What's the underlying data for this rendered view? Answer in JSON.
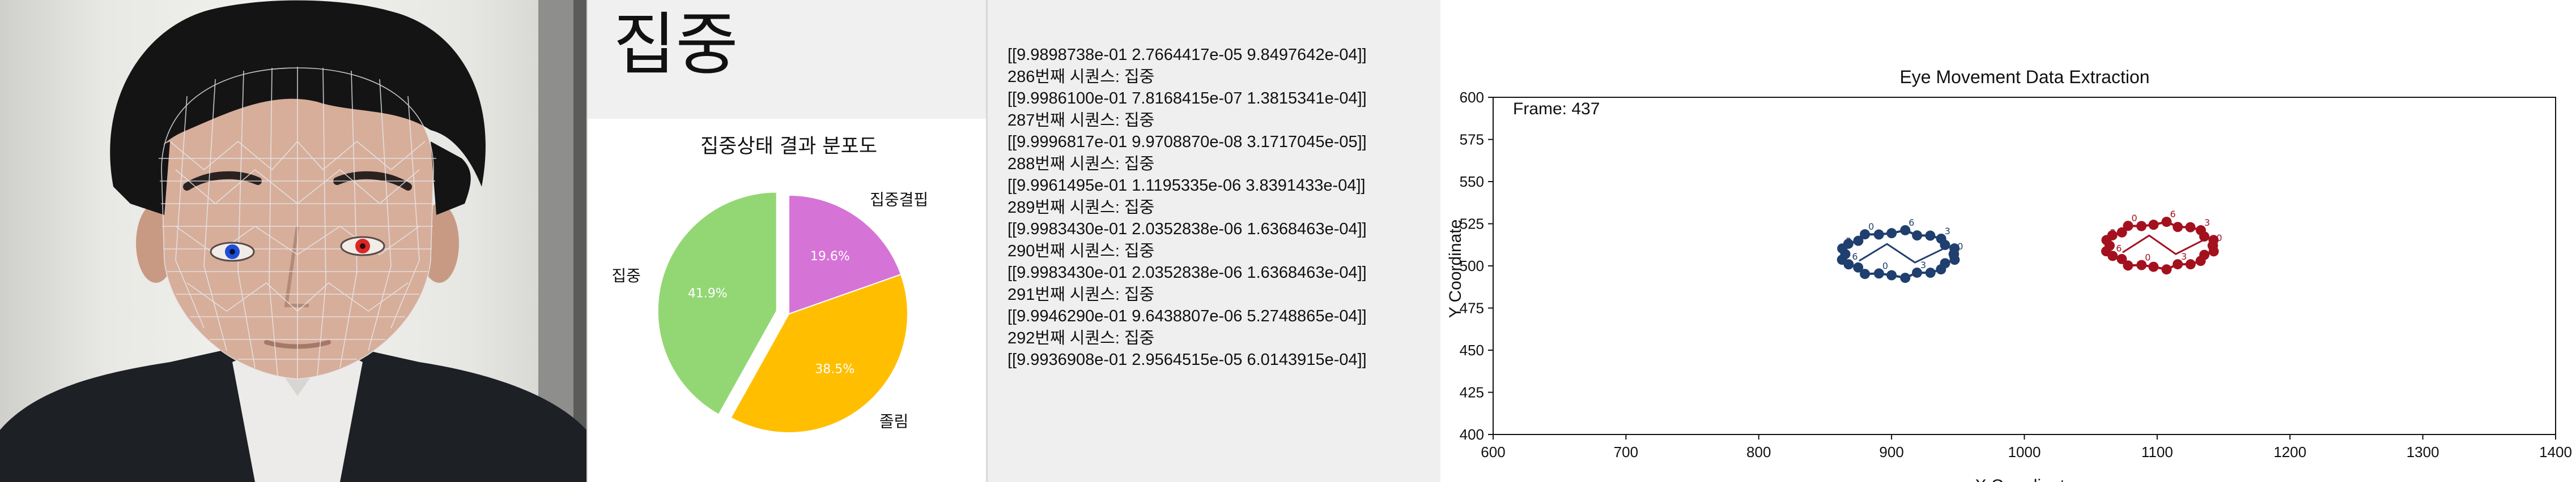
{
  "camera": {
    "description_icons": [
      "face-mesh",
      "left-eye-marker",
      "right-eye-marker"
    ],
    "colors": {
      "left_eye": "#1d4ed8",
      "right_eye": "#dc2626",
      "mesh": "#cfd3d8"
    }
  },
  "dashboard": {
    "state_title": "집중",
    "chart_data": {
      "type": "pie",
      "title": "집중상태 결과 분포도",
      "slices": [
        {
          "label": "집중결핍",
          "value": 19.6,
          "pct_label": "19.6%",
          "color": "#d673d6"
        },
        {
          "label": "졸림",
          "value": 38.5,
          "pct_label": "38.5%",
          "color": "#ffbf00"
        },
        {
          "label": "집중",
          "value": 41.9,
          "pct_label": "41.9%",
          "color": "#93d774"
        }
      ]
    }
  },
  "log": {
    "lines": [
      "[[9.9898738e-01 2.7664417e-05 9.8497642e-04]]",
      "286번째 시퀀스: 집중",
      "[[9.9986100e-01 7.8168415e-07 1.3815341e-04]]",
      "287번째 시퀀스: 집중",
      "[[9.9996817e-01 9.9708870e-08 3.1717045e-05]]",
      "288번째 시퀀스: 집중",
      "[[9.9961495e-01 1.1195335e-06 3.8391433e-04]]",
      "289번째 시퀀스: 집중",
      "[[9.9983430e-01 2.0352838e-06 1.6368463e-04]]",
      "290번째 시퀀스: 집중",
      "[[9.9983430e-01 2.0352838e-06 1.6368463e-04]]",
      "291번째 시퀀스: 집중",
      "[[9.9946290e-01 9.6438807e-06 5.2748865e-04]]",
      "292번째 시퀀스: 집중",
      "[[9.9936908e-01 2.9564515e-05 6.0143915e-04]]"
    ]
  },
  "plot": {
    "frame_label": "Frame: 437",
    "chart_data": {
      "type": "scatter",
      "title": "Eye Movement Data Extraction",
      "xlabel": "X Coordinate",
      "ylabel": "Y Coordinate",
      "xlim": [
        600,
        1400
      ],
      "ylim": [
        400,
        600
      ],
      "xticks": [
        600,
        700,
        800,
        900,
        1000,
        1100,
        1200,
        1300,
        1400
      ],
      "yticks": [
        400,
        425,
        450,
        475,
        500,
        525,
        550,
        575,
        600
      ],
      "series": [
        {
          "color": "#1f3f6e",
          "cx": 905,
          "cy": 507,
          "rx": 42,
          "ry": 13
        },
        {
          "color": "#a3111f",
          "cx": 1102,
          "cy": 512,
          "rx": 40,
          "ry": 13
        }
      ]
    }
  }
}
